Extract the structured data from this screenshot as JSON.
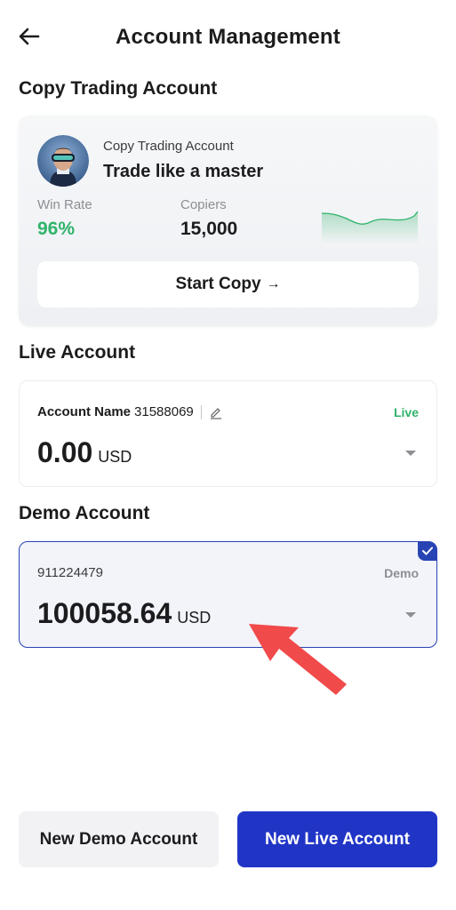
{
  "header": {
    "title": "Account Management",
    "back_icon": "arrow-left-icon"
  },
  "copy_trading": {
    "section_title": "Copy Trading Account",
    "card_subtitle": "Copy Trading Account",
    "card_title": "Trade like a master",
    "win_rate_label": "Win Rate",
    "win_rate_value": "96%",
    "copiers_label": "Copiers",
    "copiers_value": "15,000",
    "start_button": "Start Copy",
    "start_button_icon": "→",
    "win_color": "#2fb36a"
  },
  "live": {
    "section_title": "Live Account",
    "account_name_label": "Account Name",
    "account_number": "31588069",
    "tag": "Live",
    "balance": "0.00",
    "currency": "USD",
    "tag_color": "#2fb36a"
  },
  "demo": {
    "section_title": "Demo Account",
    "account_number": "911224479",
    "tag": "Demo",
    "balance": "100058.64",
    "currency": "USD",
    "selected": true,
    "accent_color": "#2844b4"
  },
  "actions": {
    "new_demo": "New Demo Account",
    "new_live": "New Live Account",
    "primary_color": "#2035c6"
  },
  "annotation": {
    "icon": "red-pointer-arrow-icon",
    "color": "#f04a4a"
  }
}
